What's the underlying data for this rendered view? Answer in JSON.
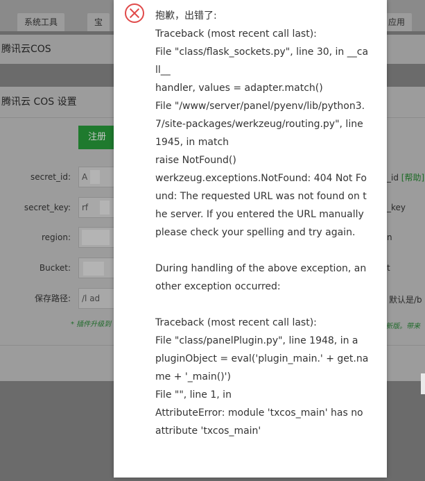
{
  "top_tabs": [
    "系统工具",
    "宝",
    "应用"
  ],
  "panel_title": "腾讯云COS",
  "dialog": {
    "title": "腾讯云 COS 设置",
    "register_button": "注册",
    "fields": [
      {
        "label": "secret_id:",
        "value": "A"
      },
      {
        "label": "secret_key:",
        "value": "rf"
      },
      {
        "label": "region:",
        "value": ""
      },
      {
        "label": "Bucket:",
        "value": ""
      },
      {
        "label": "保存路径:",
        "value": "/l   ad"
      }
    ],
    "right_texts": {
      "secret_id_hint": "_id",
      "help_link": "[帮助]",
      "key_hint": "_key",
      "region_hint": "n",
      "bucket_hint": "t",
      "path_hint": "默认是/b"
    },
    "notice": "* 插件升级到",
    "notice_right": "新版。带来"
  },
  "alert": {
    "icon": "error-icon",
    "title": "抱歉，出错了:",
    "message": "Traceback (most recent call last):\nFile \"class/flask_sockets.py\", line 30, in __call__\nhandler, values = adapter.match()\nFile \"/www/server/panel/pyenv/lib/python3.7/site-packages/werkzeug/routing.py\", line 1945, in match\nraise NotFound()\nwerkzeug.exceptions.NotFound: 404 Not Found: The requested URL was not found on the server. If you entered the URL manually please check your spelling and try again.\n\nDuring handling of the above exception, another exception occurred:\n\nTraceback (most recent call last):\nFile \"class/panelPlugin.py\", line 1948, in a\npluginObject = eval('plugin_main.' + get.name + '_main()')\nFile \"\", line 1, in\nAttributeError: module 'txcos_main' has no attribute 'txcos_main'",
    "color": "#e04a4a"
  }
}
